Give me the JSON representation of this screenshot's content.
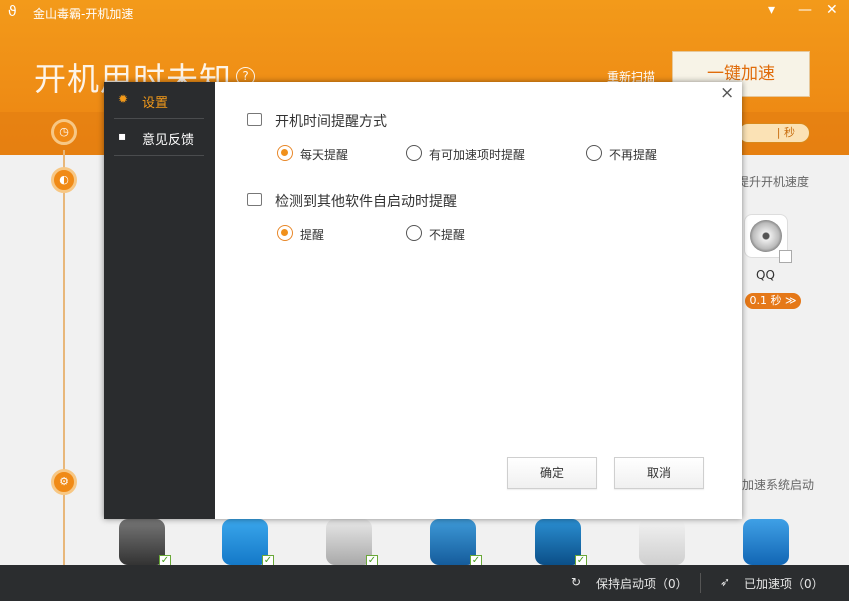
{
  "window": {
    "title": "金山毒霸-开机加速"
  },
  "header": {
    "big_title": "开机用时未知",
    "help_mark": "?",
    "rescan": "重新扫描",
    "one_key": "一键加速",
    "timer": "| 秒"
  },
  "background": {
    "right_text_1": "提升开机速度",
    "right_text_2": "加速系统启动",
    "qq_label": "QQ",
    "qq_time": "0.1 秒 ≫"
  },
  "statusbar": {
    "keep_label": "保持启动项（0）",
    "accelerated_label": "已加速项（0）"
  },
  "dialog": {
    "nav": [
      {
        "label": "设置",
        "active": true
      },
      {
        "label": "意见反馈",
        "active": false
      }
    ],
    "close": "×",
    "section1": {
      "title": "开机时间提醒方式",
      "options": [
        "每天提醒",
        "有可加速项时提醒",
        "不再提醒"
      ],
      "selected": "每天提醒"
    },
    "section2": {
      "title": "检测到其他软件自启动时提醒",
      "options": [
        "提醒",
        "不提醒"
      ],
      "selected": "提醒"
    },
    "ok": "确定",
    "cancel": "取消"
  },
  "colors": {
    "accent": "#f39a1a",
    "nav_bg": "#2a2c2e",
    "statusbar_bg": "#2b2d2f"
  }
}
